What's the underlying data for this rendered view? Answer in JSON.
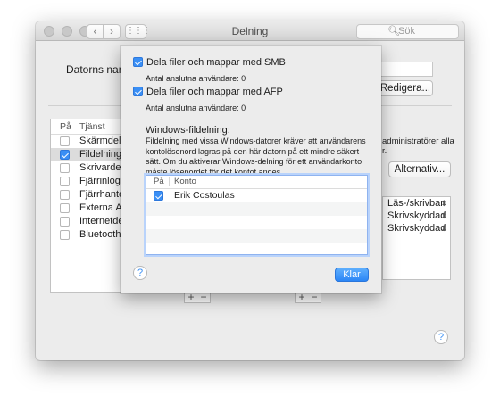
{
  "window": {
    "title": "Delning",
    "search_placeholder": "Sök",
    "nav_back": "‹",
    "nav_forward": "›",
    "grid_icon": "⋮⋮⋮"
  },
  "computer_name": {
    "label": "Datorns namn",
    "edit_button": "Redigera..."
  },
  "services": {
    "header_on": "På",
    "header_service": "Tjänst",
    "items": [
      {
        "label": "Skärmdelning",
        "checked": false
      },
      {
        "label": "Fildelning",
        "checked": true
      },
      {
        "label": "Skrivardelning",
        "checked": false
      },
      {
        "label": "Fjärrinloggning",
        "checked": false
      },
      {
        "label": "Fjärrhantering",
        "checked": false
      },
      {
        "label": "Externa Appar",
        "checked": false
      },
      {
        "label": "Internetdelning",
        "checked": false
      },
      {
        "label": "Bluetooth-delning",
        "checked": false
      }
    ]
  },
  "right_info": {
    "line1": "administratörer alla",
    "line2": "r."
  },
  "options_button": "Alternativ...",
  "permissions": [
    {
      "label": "Läs-/skrivbar",
      "arrow": "⬍"
    },
    {
      "label": "Skrivskyddad",
      "arrow": "⬍"
    },
    {
      "label": "Skrivskyddad",
      "arrow": "⬍"
    }
  ],
  "plus_minus": {
    "plus": "+",
    "minus": "−"
  },
  "help": "?",
  "sheet": {
    "smb_label": "Dela filer och mappar med SMB",
    "smb_checked": true,
    "smb_connected": "Antal anslutna användare: 0",
    "afp_label": "Dela filer och mappar med AFP",
    "afp_checked": true,
    "afp_connected": "Antal anslutna användare: 0",
    "windows_title": "Windows-fildelning:",
    "windows_desc": "Fildelning med vissa Windows-datorer kräver att användarens kontolösenord lagras på den här datorn på ett mindre säkert sätt. Om du aktiverar Windows-delning för ett användarkonto måste lösenordet för det kontot anges.",
    "table_header_on": "På",
    "table_header_account": "Konto",
    "accounts": [
      {
        "label": "Erik Costoulas",
        "checked": true
      }
    ],
    "done_button": "Klar"
  }
}
